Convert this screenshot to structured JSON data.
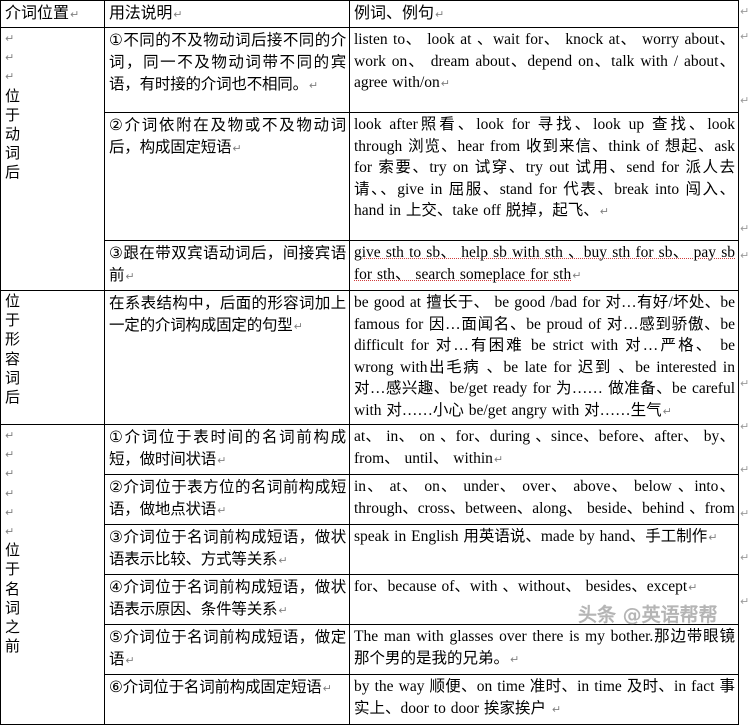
{
  "document": {
    "watermark": "头条 @英语帮帮",
    "pilcrow_glyph": "↵"
  },
  "table": {
    "headers": {
      "position": "介词位置",
      "usage": "用法说明",
      "examples": "例词、例句"
    },
    "groups": [
      {
        "position_label": "位于动词后",
        "position_chars": [
          "位",
          "于",
          "动",
          "词",
          "后"
        ],
        "position_blank_lines": 3,
        "rows": [
          {
            "usage": "①不同的不及物动词后接不同的介词，同一不及物动词带不同的宾语，有时接的介词也不相同。",
            "examples": "listen to、 look at 、wait for、 knock at、 worry about、work on、 dream about、depend on、talk with / about、agree with/on"
          },
          {
            "usage": "②介词依附在及物或不及物动词后，构成固定短语",
            "examples": "look after照看、look for 寻找、look up 查找、look through 浏览、hear from 收到来信、think of 想起、ask for 索要、try on 试穿、try out 试用、send for 派人去请、、give in 屈服、stand for 代表、break into 闯入、hand in 上交、take off 脱掉，起飞、"
          },
          {
            "usage": "③跟在带双宾语动词后，间接宾语前",
            "examples": "give sth to sb、 help sb with sth 、buy sth for sb、 pay sb for sth、 search someplace for sth"
          }
        ]
      },
      {
        "position_label": "位于形容词后",
        "position_chars": [
          "位",
          "于",
          "形",
          "容",
          "词",
          "后"
        ],
        "position_blank_lines": 0,
        "rows": [
          {
            "usage": "在系表结构中，后面的形容词加上一定的介词构成固定的句型",
            "examples": "be good at 擅长于、 be good /bad for 对…有好/坏处、be famous for 因…面闻名、be proud of 对…感到骄傲、be difficult for 对…有困难 be strict with 对…严格、 be wrong with出毛病 、be late for 迟到 、be interested in 对…感兴趣、be/get ready for 为…… 做准备、be careful with 对……小心 be/get angry with 对……生气"
          }
        ]
      },
      {
        "position_label": "位于名词之前",
        "position_chars": [
          "位",
          "于",
          "名",
          "词",
          "之",
          "前"
        ],
        "position_blank_lines": 6,
        "rows": [
          {
            "usage": "①介词位于表时间的名词前构成短，做时间状语",
            "examples": "at、 in、 on 、for、during 、since、before、after、 by、from、 until、 within"
          },
          {
            "usage": "②介词位于表方位的名词前构成短语，做地点状语",
            "examples": "in、 at、 on、 under、 over、 above、 below 、into、through、cross、between、along、 beside、behind 、from"
          },
          {
            "usage": "③介词位于名词前构成短语，做状语表示比较、方式等关系",
            "examples": "speak in English 用英语说、made by hand、手工制作"
          },
          {
            "usage": "④介词位于名词前构成短语，做状语表示原因、条件等关系",
            "examples": "for、because of、with 、without、 besides、except"
          },
          {
            "usage": "⑤介词位于名词前构成短语，做定语",
            "examples": "The man with glasses over there is my bother.那边带眼镜那个男的是我的兄弟。"
          },
          {
            "usage": "⑥介词位于名词前构成固定短语",
            "examples": "by the way 顺便、on time 准时、in time 及时、in fact 事实上、door to door 挨家挨户"
          }
        ]
      }
    ]
  }
}
